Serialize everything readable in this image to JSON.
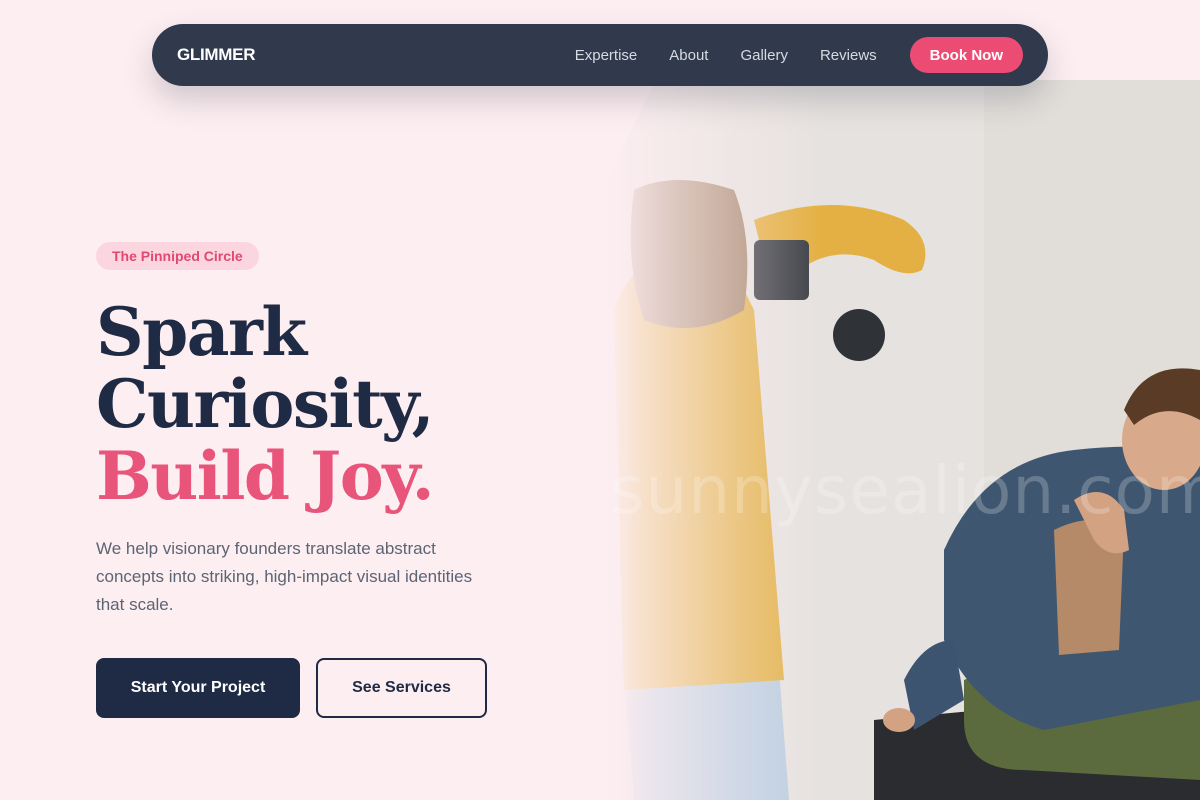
{
  "navbar": {
    "logo": "GLIMMER",
    "links": [
      "Expertise",
      "About",
      "Gallery",
      "Reviews"
    ],
    "cta": "Book Now"
  },
  "hero": {
    "badge": "The Pinniped Circle",
    "headline": [
      "Spark",
      "Curiosity,",
      "Build Joy."
    ],
    "description": "We help visionary founders translate abstract concepts into striking, high-impact visual identities that scale.",
    "primary_button": "Start Your Project",
    "secondary_button": "See Services"
  },
  "image": {
    "watermark": "sunnysealion.com"
  },
  "colors": {
    "background": "#fdeef1",
    "navbar": "#313a4d",
    "accent": "#ec4c74",
    "dark": "#1f2a44",
    "badge_bg": "#fbd5df"
  }
}
